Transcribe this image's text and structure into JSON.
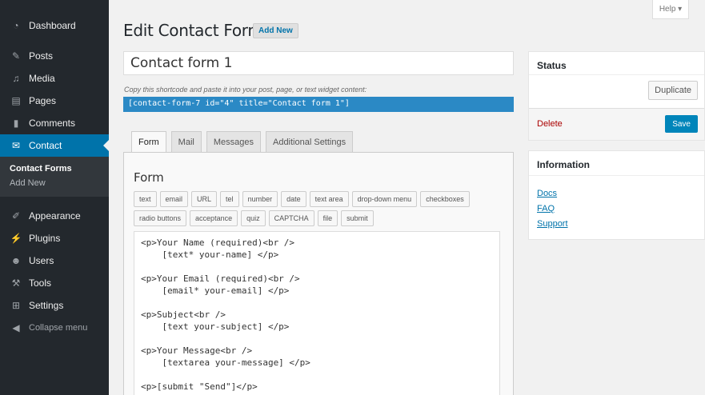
{
  "sidebar": {
    "items": [
      {
        "label": "Dashboard",
        "icon": "dashboard-icon"
      },
      {
        "label": "Posts",
        "icon": "pin-icon"
      },
      {
        "label": "Media",
        "icon": "media-icon"
      },
      {
        "label": "Pages",
        "icon": "pages-icon"
      },
      {
        "label": "Comments",
        "icon": "comments-icon"
      },
      {
        "label": "Contact",
        "icon": "mail-icon"
      }
    ],
    "submenu": [
      "Contact Forms",
      "Add New"
    ],
    "items2": [
      {
        "label": "Appearance",
        "icon": "brush-icon"
      },
      {
        "label": "Plugins",
        "icon": "plugin-icon"
      },
      {
        "label": "Users",
        "icon": "users-icon"
      },
      {
        "label": "Tools",
        "icon": "wrench-icon"
      },
      {
        "label": "Settings",
        "icon": "settings-icon"
      }
    ],
    "collapse": "Collapse menu"
  },
  "help": "Help ▾",
  "header": {
    "title": "Edit Contact Form",
    "add_new": "Add New"
  },
  "form_title": "Contact form 1",
  "shortcode_hint": "Copy this shortcode and paste it into your post, page, or text widget content:",
  "shortcode": "[contact-form-7 id=\"4\" title=\"Contact form 1\"]",
  "tabs": [
    "Form",
    "Mail",
    "Messages",
    "Additional Settings"
  ],
  "form": {
    "heading": "Form",
    "tags_row1": [
      "text",
      "email",
      "URL",
      "tel",
      "number",
      "date",
      "text area",
      "drop-down menu",
      "checkboxes"
    ],
    "tags_row2": [
      "radio buttons",
      "acceptance",
      "quiz",
      "CAPTCHA",
      "file",
      "submit"
    ],
    "code": "<p>Your Name (required)<br />\n    [text* your-name] </p>\n\n<p>Your Email (required)<br />\n    [email* your-email] </p>\n\n<p>Subject<br />\n    [text your-subject] </p>\n\n<p>Your Message<br />\n    [textarea your-message] </p>\n\n<p>[submit \"Send\"]</p>"
  },
  "status": {
    "title": "Status",
    "duplicate": "Duplicate",
    "delete": "Delete",
    "save": "Save"
  },
  "information": {
    "title": "Information",
    "links": [
      "Docs",
      "FAQ",
      "Support"
    ]
  }
}
